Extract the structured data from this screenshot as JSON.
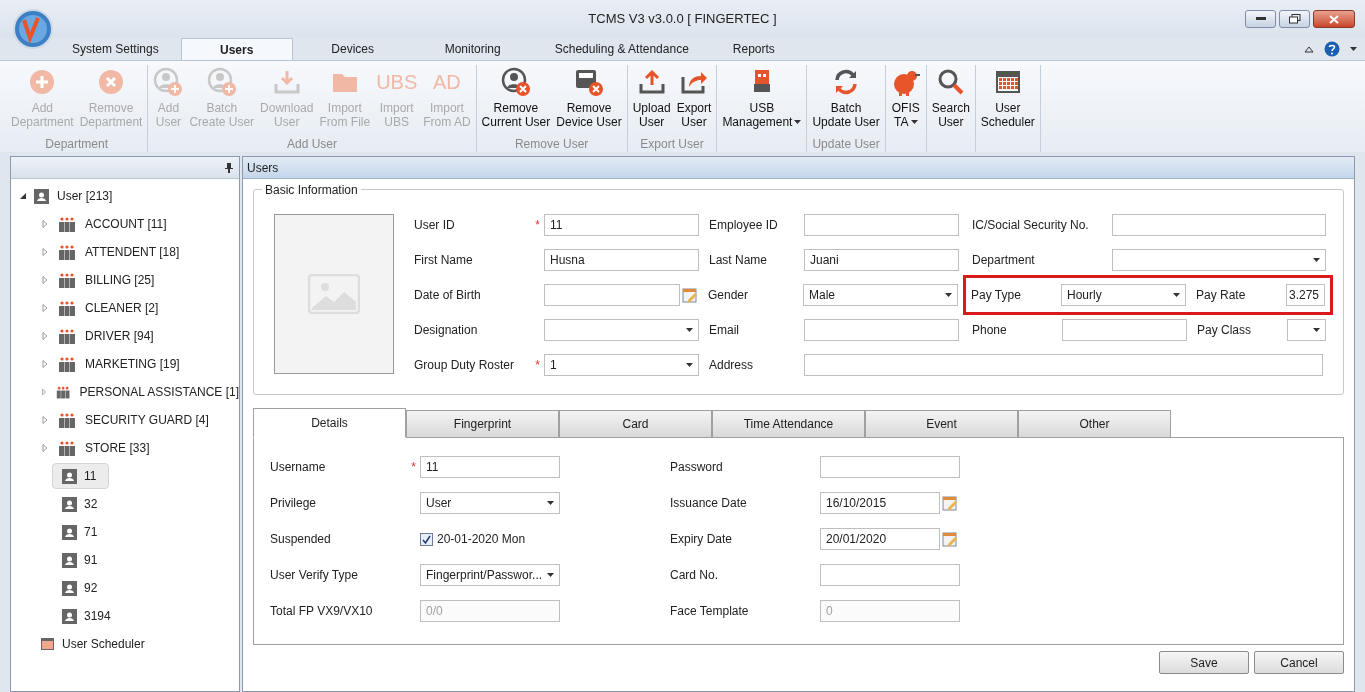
{
  "window": {
    "title": "TCMS V3 v3.0.0 [ FINGERTEC ]"
  },
  "ribbon_tabs": [
    {
      "label": "System Settings",
      "selected": false
    },
    {
      "label": "Users",
      "selected": true
    },
    {
      "label": "Devices",
      "selected": false
    },
    {
      "label": "Monitoring",
      "selected": false
    },
    {
      "label": "Scheduling & Attendance",
      "selected": false
    },
    {
      "label": "Reports",
      "selected": false
    }
  ],
  "ribbon_groups": [
    {
      "label": "Department",
      "buttons": [
        {
          "lines": [
            "Add",
            "Department"
          ],
          "kind": "plus",
          "disabled": true,
          "dropdown": false
        },
        {
          "lines": [
            "Remove",
            "Department"
          ],
          "kind": "cross",
          "disabled": true,
          "dropdown": false
        }
      ]
    },
    {
      "label": "Add User",
      "buttons": [
        {
          "lines": [
            "Add",
            "User"
          ],
          "kind": "user-plus",
          "disabled": true,
          "dropdown": false
        },
        {
          "lines": [
            "Batch",
            "Create User"
          ],
          "kind": "user-plus",
          "disabled": true,
          "dropdown": false
        },
        {
          "lines": [
            "Download",
            "User"
          ],
          "kind": "download",
          "disabled": true,
          "dropdown": false
        },
        {
          "lines": [
            "Import",
            "From File"
          ],
          "kind": "folder",
          "disabled": true,
          "dropdown": false
        },
        {
          "lines": [
            "Import",
            "UBS"
          ],
          "kind": "lettermark",
          "icon_text": "UBS",
          "disabled": true,
          "dropdown": false
        },
        {
          "lines": [
            "Import",
            "From AD"
          ],
          "kind": "lettermark",
          "icon_text": "AD",
          "disabled": true,
          "dropdown": false
        }
      ]
    },
    {
      "label": "Remove User",
      "buttons": [
        {
          "lines": [
            "Remove",
            "Current User"
          ],
          "kind": "user-remove",
          "disabled": false,
          "dropdown": false
        },
        {
          "lines": [
            "Remove",
            "Device User"
          ],
          "kind": "device-remove",
          "disabled": false,
          "dropdown": false
        }
      ]
    },
    {
      "label": "Export User",
      "buttons": [
        {
          "lines": [
            "Upload",
            "User"
          ],
          "kind": "upload",
          "disabled": false,
          "dropdown": false
        },
        {
          "lines": [
            "Export",
            "User"
          ],
          "kind": "export",
          "disabled": false,
          "dropdown": false
        }
      ]
    },
    {
      "buttons": [
        {
          "lines": [
            "USB",
            "Management"
          ],
          "kind": "usb",
          "disabled": false,
          "dropdown": true
        }
      ]
    },
    {
      "label": "Update User",
      "buttons": [
        {
          "lines": [
            "Batch",
            "Update User"
          ],
          "kind": "sync",
          "disabled": false,
          "dropdown": false
        }
      ]
    },
    {
      "buttons": [
        {
          "lines": [
            "OFIS",
            "TA"
          ],
          "kind": "ofis",
          "disabled": false,
          "dropdown": true
        }
      ]
    },
    {
      "buttons": [
        {
          "lines": [
            "Search",
            "User"
          ],
          "kind": "search",
          "disabled": false,
          "dropdown": false
        }
      ]
    },
    {
      "buttons": [
        {
          "lines": [
            "User",
            "Scheduler"
          ],
          "kind": "calendar",
          "disabled": false,
          "dropdown": false
        }
      ]
    }
  ],
  "tree": {
    "label": "User [213]",
    "expanded": true,
    "children": [
      {
        "kind": "department",
        "label": "ACCOUNT [11]",
        "expanded": false
      },
      {
        "kind": "department",
        "label": "ATTENDENT [18]",
        "expanded": false
      },
      {
        "kind": "department",
        "label": "BILLING [25]",
        "expanded": false
      },
      {
        "kind": "department",
        "label": "CLEANER [2]",
        "expanded": false
      },
      {
        "kind": "department",
        "label": "DRIVER [94]",
        "expanded": false
      },
      {
        "kind": "department",
        "label": "MARKETING [19]",
        "expanded": false
      },
      {
        "kind": "department",
        "label": "PERSONAL ASSISTANCE [1]",
        "expanded": false
      },
      {
        "kind": "department",
        "label": "SECURITY GUARD [4]",
        "expanded": false
      },
      {
        "kind": "department",
        "label": "STORE [33]",
        "expanded": false
      },
      {
        "kind": "user",
        "label": "11",
        "selected": true
      },
      {
        "kind": "user",
        "label": "32",
        "selected": false
      },
      {
        "kind": "user",
        "label": "71",
        "selected": false
      },
      {
        "kind": "user",
        "label": "91",
        "selected": false
      },
      {
        "kind": "user",
        "label": "92",
        "selected": false
      },
      {
        "kind": "user",
        "label": "3194",
        "selected": false
      }
    ]
  },
  "tree_extra": {
    "label": "User Scheduler"
  },
  "panel": {
    "title": "Users"
  },
  "basic_info": {
    "title": "Basic Information",
    "rows": [
      {
        "left": {
          "label": "User ID",
          "kind": "text",
          "value": "11",
          "required_mark": "*"
        },
        "middle": {
          "label": "Employee ID",
          "kind": "text"
        },
        "right": [
          {
            "label": "IC/Social Security No.",
            "kind": "text"
          }
        ]
      },
      {
        "left": {
          "label": "First Name",
          "kind": "text",
          "value": "Husna"
        },
        "middle": {
          "label": "Last Name",
          "kind": "text",
          "value": "Juani"
        },
        "right": [
          {
            "label": "Department",
            "kind": "select"
          }
        ]
      },
      {
        "left": {
          "label": "Date of Birth",
          "kind": "date"
        },
        "middle": {
          "label": "Gender",
          "kind": "select",
          "value": "Male"
        },
        "right": [
          {
            "label": "Pay Type",
            "kind": "select",
            "value": "Hourly"
          },
          {
            "label": "Pay Rate",
            "kind": "number",
            "value": "3.275"
          }
        ],
        "highlighted": true
      },
      {
        "left": {
          "label": "Designation",
          "kind": "select"
        },
        "middle": {
          "label": "Email",
          "kind": "text"
        },
        "right": [
          {
            "label": "Phone",
            "kind": "text"
          },
          {
            "label": "Pay Class",
            "kind": "select"
          }
        ]
      },
      {
        "left": {
          "label": "Group Duty Roster",
          "kind": "select",
          "value": "1",
          "required_mark": "*"
        },
        "middle": {
          "label": "Address",
          "kind": "wide-text"
        },
        "right": []
      }
    ]
  },
  "detail_tabs": [
    {
      "label": "Details",
      "selected": true
    },
    {
      "label": "Fingerprint",
      "selected": false
    },
    {
      "label": "Card",
      "selected": false
    },
    {
      "label": "Time Attendance",
      "selected": false
    },
    {
      "label": "Event",
      "selected": false
    },
    {
      "label": "Other",
      "selected": false
    }
  ],
  "details": {
    "left": [
      {
        "label": "Username",
        "kind": "text",
        "value": "11",
        "required_mark": "*"
      },
      {
        "label": "Privilege",
        "kind": "select",
        "value": "User"
      },
      {
        "label": "Suspended",
        "kind": "checkbox",
        "value": "20-01-2020 Mon",
        "checked": true
      },
      {
        "label": "User Verify Type",
        "kind": "select",
        "value": "Fingerprint/Passwor..."
      },
      {
        "label": "Total FP VX9/VX10",
        "kind": "text",
        "value": "0/0",
        "disabled": true
      }
    ],
    "right": [
      {
        "label": "Password",
        "kind": "text"
      },
      {
        "label": "Issuance Date",
        "kind": "date",
        "value": "16/10/2015"
      },
      {
        "label": "Expiry Date",
        "kind": "date",
        "value": "20/01/2020"
      },
      {
        "label": "Card No.",
        "kind": "text"
      },
      {
        "label": "Face Template",
        "kind": "text",
        "value": "0",
        "disabled": true
      }
    ]
  },
  "actions": [
    "Save",
    "Cancel"
  ]
}
